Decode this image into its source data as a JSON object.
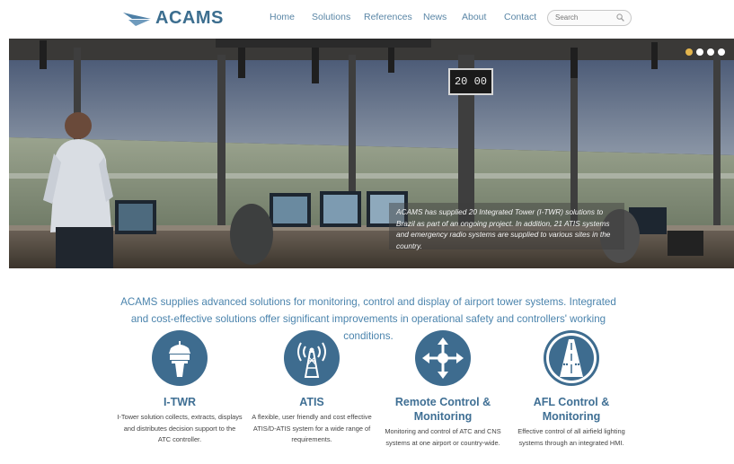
{
  "brand": {
    "name": "ACAMS"
  },
  "nav": {
    "items": [
      {
        "label": "Home"
      },
      {
        "label": "Solutions"
      },
      {
        "label": "References"
      },
      {
        "label": "News"
      },
      {
        "label": "About"
      },
      {
        "label": "Contact"
      }
    ]
  },
  "search": {
    "placeholder": "Search"
  },
  "hero": {
    "clock_text": "20 00",
    "caption": "ACAMS has supplied 20 Integrated Tower (I-TWR) solutions to Brazil as part of an ongoing project. In addition, 21 ATIS systems and emergency radio systems are supplied to various sites in the country.",
    "slider_dots": 4,
    "active_dot": 1
  },
  "intro": {
    "text": "ACAMS supplies advanced solutions for monitoring, control and display of airport tower systems. Integrated and cost-effective solutions offer significant improvements in operational safety and controllers' working conditions."
  },
  "features": [
    {
      "icon": "control-tower-icon",
      "title": "I-TWR",
      "description": "I-Tower solution collects, extracts, displays and distributes decision support to the ATC controller."
    },
    {
      "icon": "radio-antenna-icon",
      "title": "ATIS",
      "description": "A flexible, user friendly and cost effective ATIS/D-ATIS system for a wide range of requirements."
    },
    {
      "icon": "four-way-arrows-icon",
      "title": "Remote Control & Monitoring",
      "description": "Monitoring and control of ATC and CNS systems at one airport or country-wide."
    },
    {
      "icon": "runway-lights-icon",
      "title": "AFL Control & Monitoring",
      "description": "Effective control of all airfield lighting systems through an integrated HMI."
    }
  ],
  "colors": {
    "brand_blue": "#3e6c8f",
    "link_blue": "#5a86a6",
    "intro_blue": "#4b84ad",
    "active_dot": "#e3b54d"
  }
}
